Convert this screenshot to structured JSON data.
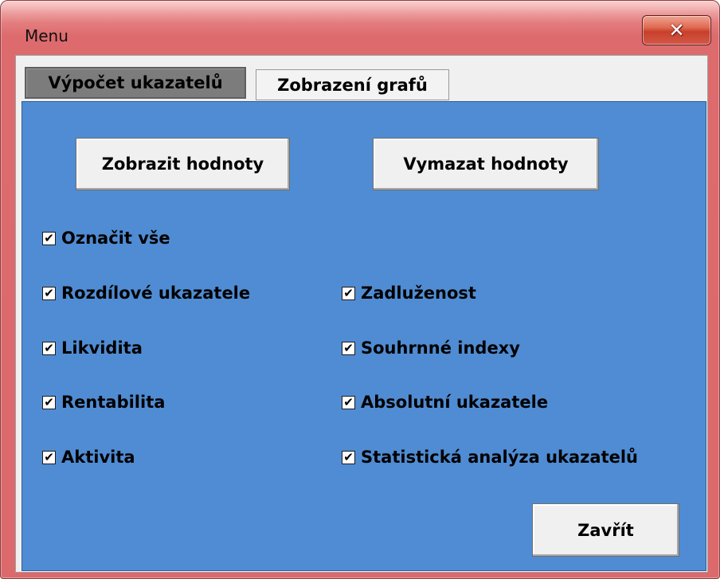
{
  "window": {
    "title": "Menu",
    "close_glyph": "✕",
    "frame_color": "#dc6a6c",
    "panel_color": "#508cd3"
  },
  "tabs": [
    {
      "label": "Výpočet ukazatelů",
      "active": true
    },
    {
      "label": "Zobrazení grafů",
      "active": false
    }
  ],
  "buttons": {
    "show_values": "Zobrazit hodnoty",
    "clear_values": "Vymazat hodnoty",
    "close": "Zavřít"
  },
  "checkboxes": {
    "select_all": {
      "label": "Označit vše",
      "checked": true
    },
    "left": [
      {
        "label": "Rozdílové ukazatele",
        "checked": true
      },
      {
        "label": "Likvidita",
        "checked": true
      },
      {
        "label": "Rentabilita",
        "checked": true
      },
      {
        "label": "Aktivita",
        "checked": true
      }
    ],
    "right": [
      {
        "label": "Zadluženost",
        "checked": true
      },
      {
        "label": "Souhrnné indexy",
        "checked": true
      },
      {
        "label": "Absolutní ukazatele",
        "checked": true
      },
      {
        "label": "Statistická analýza ukazatelů",
        "checked": true
      }
    ],
    "check_glyph": "✔"
  }
}
